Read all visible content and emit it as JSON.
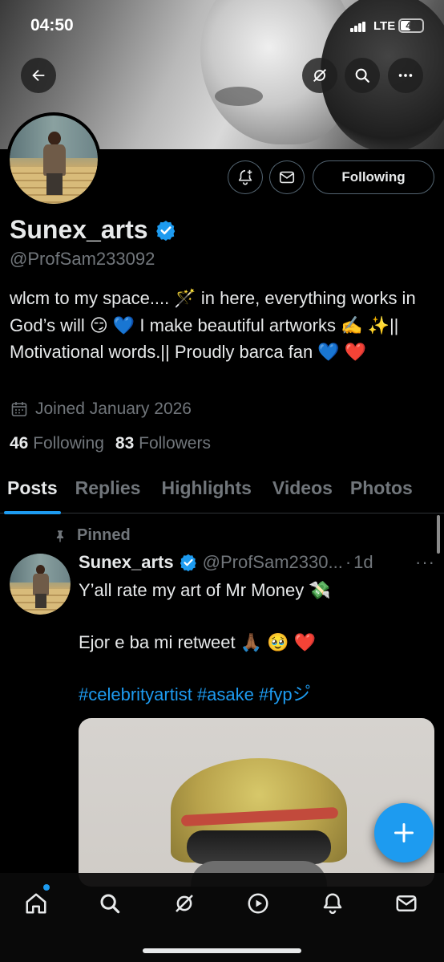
{
  "status_bar": {
    "time": "04:50",
    "network": "LTE",
    "battery": "44"
  },
  "profile": {
    "display_name": "Sunex_arts",
    "handle": "@ProfSam233092",
    "bio": "wlcm to my space.... 🪄 in here, everything works in God’s will 😏 💙 I make beautiful artworks ✍️ ✨|| Motivational words.|| Proudly barca fan 💙 ❤️",
    "joined": "Joined January 2026",
    "following_count": "46",
    "following_label": "Following",
    "followers_count": "83",
    "followers_label": "Followers",
    "follow_button_label": "Following"
  },
  "tabs": [
    "Posts",
    "Replies",
    "Highlights",
    "Videos",
    "Photos"
  ],
  "active_tab": "Posts",
  "pinned_post": {
    "pinned_label": "Pinned",
    "author_name": "Sunex_arts",
    "author_handle": "@ProfSam2330...",
    "time": "1d",
    "line1": "Y’all rate my art of Mr Money 💸",
    "line2": "Ejor e ba mi retweet 🙏🏾 🥹 ❤️",
    "hashtags": "#celebrityartist #asake #fypシ゚"
  },
  "icons": {
    "back": "back-arrow-icon",
    "grok": "grok-icon",
    "search": "search-icon",
    "more": "more-icon",
    "notify": "notification-bell-plus-icon",
    "message": "envelope-icon",
    "verified": "verified-badge-icon",
    "calendar": "calendar-icon",
    "pin": "pin-icon",
    "compose": "plus-icon"
  },
  "bottom_nav": [
    "home",
    "search",
    "grok",
    "video",
    "notifications",
    "messages"
  ],
  "colors": {
    "accent": "#1d9bf0",
    "background": "#000000",
    "text": "#e7e9ea",
    "muted": "#71767b"
  }
}
